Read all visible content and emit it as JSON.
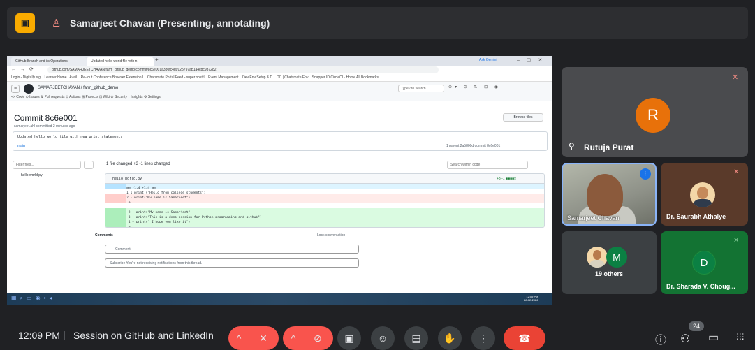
{
  "presenter": {
    "title": "Samarjeet Chavan (Presenting, annotating)"
  },
  "browser": {
    "tab1": "GitHub Branch and its Operations",
    "tab2": "Updated hello world file with n",
    "ask_gemini": "Ask Gemini",
    "url": "github.com/SAMARJEETCHAVAN/farm_github_demo/commit/8c6e001a3b0fc4d9925797ab1a4cbc937282",
    "bookmarks": "Login - Digitally sig...   Learner Home | Avail...   Re-rout Conference   Browser Extension I...   Chatsmate Portal   Feed - super.nostrl...   Event Management...   Dev Env Setup & D...   OC | Chatsmate Env...   Snapper ID   CircleCI · Home   All Bookmarks"
  },
  "github": {
    "repo_path": "SAMARJEETCHAVAN / farm_github_demo",
    "search_placeholder": "Type / to search",
    "nav": "<> Code    ⊙ Issues    ⇅ Pull requests    ⊙ Actions    ⊞ Projects    ⊡ Wiki    ⊘ Security    ⌇ Insights    ⚙ Settings",
    "commit_title": "Commit 8c6e001",
    "browse_files": "Browse files",
    "commit_author": "samarjeet.ahl committed 2 minutes ago",
    "commit_message": "Updated hello world file with new print statements",
    "branch": "main",
    "commit_meta": "1 parent  2a5800d  commit 8c6e001",
    "filter_placeholder": "Filter files...",
    "file_tree_item": "hello world.py",
    "files_changed": "1 file changed  +3 -1 lines changed",
    "search_within": "Search within code",
    "diff_file": "hello world.py",
    "diff_stat": "+3 -1 ■■■■□",
    "diff_lines": [
      {
        "type": "hunk",
        "text": "@@ -1,4 +1,4 @@"
      },
      {
        "type": "ctx",
        "text": "1   1   print (\"Hello from college students\")"
      },
      {
        "type": "del",
        "text": "2       - print(\"My name is Samarjeet\")"
      },
      {
        "type": "del",
        "text": "           ⊖"
      },
      {
        "type": "ctx",
        "text": ""
      },
      {
        "type": "add",
        "text": "    2   + print(\"My name is Samarjeet\")"
      },
      {
        "type": "add",
        "text": "    3   + print(\"This is a demo session for Python programming and github\")"
      },
      {
        "type": "add",
        "text": "    4   + print(\" I hope you like it\")"
      },
      {
        "type": "add",
        "text": "           ⊖"
      }
    ],
    "comments_label": "Comments",
    "lock_conversation": "Lock conversation",
    "comment_placeholder": "Comment",
    "subscribe_text": "Subscribe   You're not receiving notifications from this thread.",
    "taskbar_time": "12:09 PM\n28-02-2026"
  },
  "participants": {
    "rutuja": {
      "initial": "R",
      "name": "Rutuja Purat",
      "avatar_color": "#e8710a"
    },
    "samarjeet": {
      "name": "Samarjeet Chavan"
    },
    "saurabh": {
      "name": "Dr. Saurabh Athalye"
    },
    "others": {
      "initial": "M",
      "label": "19 others"
    },
    "sharada": {
      "initial": "D",
      "name": "Dr. Sharada V. Choug..."
    }
  },
  "meeting": {
    "time": "12:09 PM",
    "separator": "|",
    "title": "Session on GitHub and LinkedIn",
    "people_count": "24"
  },
  "icons": {
    "mic": "mic-off-icon",
    "camera": "camera-off-icon",
    "present": "present-screen-icon",
    "emoji": "emoji-icon",
    "captions": "captions-icon",
    "hand": "raise-hand-icon",
    "more": "more-vert-icon",
    "leave": "call-end-icon",
    "info": "info-icon",
    "people": "people-icon",
    "chat": "chat-icon",
    "activities": "apps-icon"
  }
}
